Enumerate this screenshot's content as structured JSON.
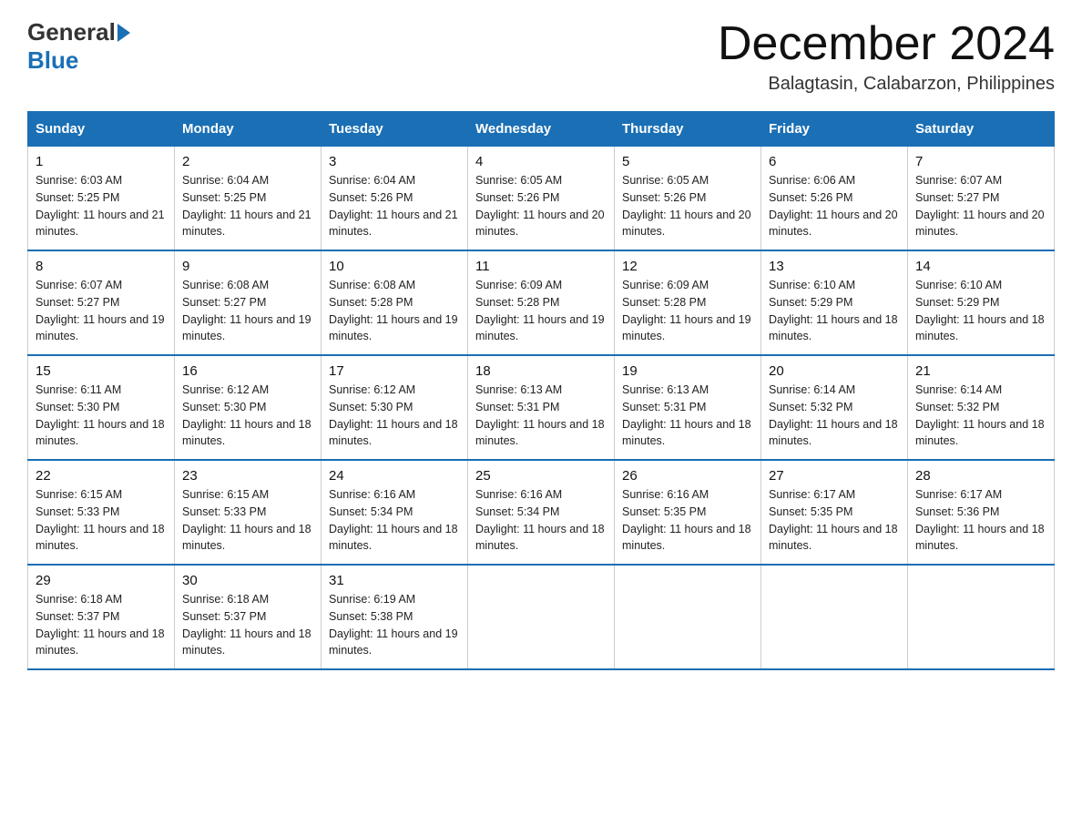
{
  "header": {
    "logo_general": "General",
    "logo_blue": "Blue",
    "month_title": "December 2024",
    "location": "Balagtasin, Calabarzon, Philippines"
  },
  "weekdays": [
    "Sunday",
    "Monday",
    "Tuesday",
    "Wednesday",
    "Thursday",
    "Friday",
    "Saturday"
  ],
  "weeks": [
    [
      {
        "day": "1",
        "sunrise": "6:03 AM",
        "sunset": "5:25 PM",
        "daylight": "11 hours and 21 minutes."
      },
      {
        "day": "2",
        "sunrise": "6:04 AM",
        "sunset": "5:25 PM",
        "daylight": "11 hours and 21 minutes."
      },
      {
        "day": "3",
        "sunrise": "6:04 AM",
        "sunset": "5:26 PM",
        "daylight": "11 hours and 21 minutes."
      },
      {
        "day": "4",
        "sunrise": "6:05 AM",
        "sunset": "5:26 PM",
        "daylight": "11 hours and 20 minutes."
      },
      {
        "day": "5",
        "sunrise": "6:05 AM",
        "sunset": "5:26 PM",
        "daylight": "11 hours and 20 minutes."
      },
      {
        "day": "6",
        "sunrise": "6:06 AM",
        "sunset": "5:26 PM",
        "daylight": "11 hours and 20 minutes."
      },
      {
        "day": "7",
        "sunrise": "6:07 AM",
        "sunset": "5:27 PM",
        "daylight": "11 hours and 20 minutes."
      }
    ],
    [
      {
        "day": "8",
        "sunrise": "6:07 AM",
        "sunset": "5:27 PM",
        "daylight": "11 hours and 19 minutes."
      },
      {
        "day": "9",
        "sunrise": "6:08 AM",
        "sunset": "5:27 PM",
        "daylight": "11 hours and 19 minutes."
      },
      {
        "day": "10",
        "sunrise": "6:08 AM",
        "sunset": "5:28 PM",
        "daylight": "11 hours and 19 minutes."
      },
      {
        "day": "11",
        "sunrise": "6:09 AM",
        "sunset": "5:28 PM",
        "daylight": "11 hours and 19 minutes."
      },
      {
        "day": "12",
        "sunrise": "6:09 AM",
        "sunset": "5:28 PM",
        "daylight": "11 hours and 19 minutes."
      },
      {
        "day": "13",
        "sunrise": "6:10 AM",
        "sunset": "5:29 PM",
        "daylight": "11 hours and 18 minutes."
      },
      {
        "day": "14",
        "sunrise": "6:10 AM",
        "sunset": "5:29 PM",
        "daylight": "11 hours and 18 minutes."
      }
    ],
    [
      {
        "day": "15",
        "sunrise": "6:11 AM",
        "sunset": "5:30 PM",
        "daylight": "11 hours and 18 minutes."
      },
      {
        "day": "16",
        "sunrise": "6:12 AM",
        "sunset": "5:30 PM",
        "daylight": "11 hours and 18 minutes."
      },
      {
        "day": "17",
        "sunrise": "6:12 AM",
        "sunset": "5:30 PM",
        "daylight": "11 hours and 18 minutes."
      },
      {
        "day": "18",
        "sunrise": "6:13 AM",
        "sunset": "5:31 PM",
        "daylight": "11 hours and 18 minutes."
      },
      {
        "day": "19",
        "sunrise": "6:13 AM",
        "sunset": "5:31 PM",
        "daylight": "11 hours and 18 minutes."
      },
      {
        "day": "20",
        "sunrise": "6:14 AM",
        "sunset": "5:32 PM",
        "daylight": "11 hours and 18 minutes."
      },
      {
        "day": "21",
        "sunrise": "6:14 AM",
        "sunset": "5:32 PM",
        "daylight": "11 hours and 18 minutes."
      }
    ],
    [
      {
        "day": "22",
        "sunrise": "6:15 AM",
        "sunset": "5:33 PM",
        "daylight": "11 hours and 18 minutes."
      },
      {
        "day": "23",
        "sunrise": "6:15 AM",
        "sunset": "5:33 PM",
        "daylight": "11 hours and 18 minutes."
      },
      {
        "day": "24",
        "sunrise": "6:16 AM",
        "sunset": "5:34 PM",
        "daylight": "11 hours and 18 minutes."
      },
      {
        "day": "25",
        "sunrise": "6:16 AM",
        "sunset": "5:34 PM",
        "daylight": "11 hours and 18 minutes."
      },
      {
        "day": "26",
        "sunrise": "6:16 AM",
        "sunset": "5:35 PM",
        "daylight": "11 hours and 18 minutes."
      },
      {
        "day": "27",
        "sunrise": "6:17 AM",
        "sunset": "5:35 PM",
        "daylight": "11 hours and 18 minutes."
      },
      {
        "day": "28",
        "sunrise": "6:17 AM",
        "sunset": "5:36 PM",
        "daylight": "11 hours and 18 minutes."
      }
    ],
    [
      {
        "day": "29",
        "sunrise": "6:18 AM",
        "sunset": "5:37 PM",
        "daylight": "11 hours and 18 minutes."
      },
      {
        "day": "30",
        "sunrise": "6:18 AM",
        "sunset": "5:37 PM",
        "daylight": "11 hours and 18 minutes."
      },
      {
        "day": "31",
        "sunrise": "6:19 AM",
        "sunset": "5:38 PM",
        "daylight": "11 hours and 19 minutes."
      },
      null,
      null,
      null,
      null
    ]
  ]
}
